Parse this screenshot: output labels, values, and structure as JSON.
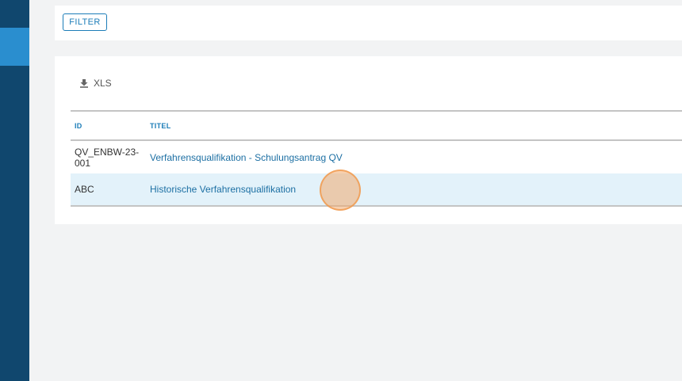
{
  "colors": {
    "sidebar": "#10476e",
    "sidebar_active": "#2a8ecf",
    "accent": "#1c7db8",
    "row_highlight": "#e3f2fa"
  },
  "filter": {
    "button_label": "FILTER"
  },
  "toolbar": {
    "xls_label": "XLS",
    "xls_icon": "download-icon"
  },
  "table": {
    "headers": {
      "id": "ID",
      "title": "TITEL"
    },
    "rows": [
      {
        "id": "QV_ENBW-23-\n001",
        "title": "Verfahrensqualifikation - Schulungsantrag QV"
      },
      {
        "id": "ABC",
        "title": "Historische Verfahrensqualifikation"
      }
    ]
  }
}
